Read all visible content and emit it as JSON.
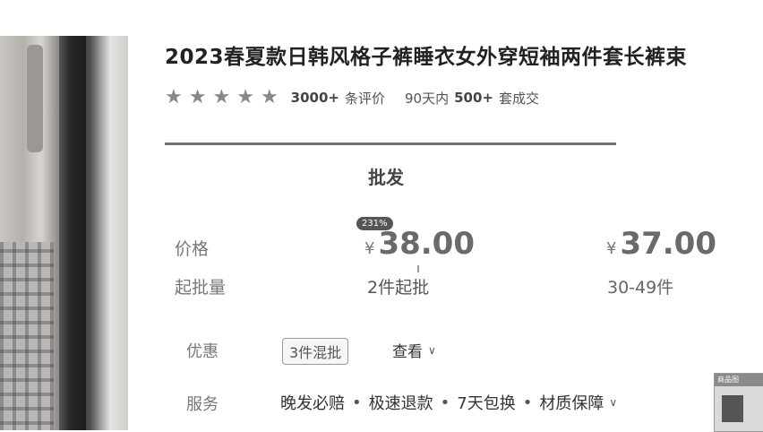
{
  "product": {
    "title": "2023春夏款日韩风格子裤睡衣女外穿短袖两件套长裤束"
  },
  "rating": {
    "stars": 5,
    "review_count": "3000+",
    "review_suffix": "条评价",
    "period": "90天内",
    "deals_count": "500+",
    "deals_suffix": "套成交"
  },
  "wholesale": {
    "label": "批发",
    "price_label": "价格",
    "moq_label": "起批量",
    "tiers": [
      {
        "currency": "¥",
        "price": "38.00",
        "moq": "2件起批"
      },
      {
        "currency": "¥",
        "price": "37.00",
        "moq": "30-49件"
      }
    ],
    "percent_badge": "231%"
  },
  "discount": {
    "label": "优惠",
    "tag": "3件混批",
    "view_label": "查看"
  },
  "service": {
    "label": "服务",
    "items": [
      "晚发必赔",
      "极速退款",
      "7天包换",
      "材质保障"
    ]
  },
  "thumbnail": {
    "header": "商品图"
  },
  "icons": {
    "star": "star-icon",
    "chevron": "chevron-down-icon"
  }
}
